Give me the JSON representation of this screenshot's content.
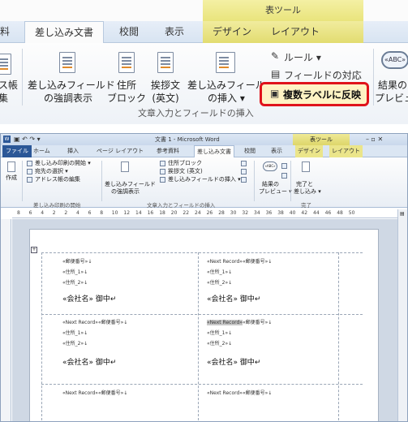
{
  "zoom": {
    "tool_header": "表ツール",
    "tabs": [
      "料",
      "差し込み文書",
      "校閲",
      "表示",
      "デザイン",
      "レイアウト"
    ],
    "buttons": {
      "address_book_l1": "ス帳",
      "address_book_l2": "集",
      "highlight_fields_l1": "差し込みフィールド",
      "highlight_fields_l2": "の強調表示",
      "address_block_l1": "住所",
      "address_block_l2": "ブロック",
      "greeting_l1": "挨拶文",
      "greeting_l2": "(英文)",
      "insert_field_l1": "差し込みフィールド",
      "insert_field_l2": "の挿入 ▾",
      "rules": "ルール ▾",
      "match_fields": "フィールドの対応",
      "update_labels": "複数ラベルに反映",
      "preview_l1": "結果の",
      "preview_l2": "プレビュー"
    },
    "group_label": "文章入力とフィールドの挿入"
  },
  "word": {
    "title": "文書 1 - Microsoft Word",
    "tool_header": "表ツール",
    "tabs": [
      "ファイル",
      "ホーム",
      "挿入",
      "ページ レイアウト",
      "参考資料",
      "差し込み文書",
      "校閲",
      "表示",
      "デザイン",
      "レイアウト"
    ],
    "ribbon": {
      "create": "作成",
      "start_merge": "差し込み印刷の開始 ▾",
      "select_recipients": "宛先の選択 ▾",
      "edit_recipients": "アドレス帳の編集",
      "highlight_l1": "差し込みフィールド",
      "highlight_l2": "の強調表示",
      "address_block": "住所ブロック",
      "greeting": "挨拶文 (英文)",
      "insert_field": "差し込みフィールドの挿入 ▾",
      "preview_l1": "結果の",
      "preview_l2": "プレビュー ▾",
      "finish_l1": "完了と",
      "finish_l2": "差し込み ▾",
      "group_start": "差し込み印刷の開始",
      "group_fields": "文章入力とフィールドの挿入",
      "group_preview": "結果のプレビュー",
      "group_finish": "完了"
    },
    "ruler_numbers": [
      "8",
      "6",
      "4",
      "2",
      "2",
      "4",
      "6",
      "8",
      "10",
      "12",
      "14",
      "16",
      "18",
      "20",
      "22",
      "24",
      "26",
      "28",
      "30",
      "32",
      "34",
      "36",
      "38",
      "40",
      "42",
      "44",
      "46",
      "48",
      "50"
    ],
    "labels": {
      "postal": "«郵便番号»↓",
      "addr1": "«住所_1»↓",
      "addr2": "«住所_2»↓",
      "company": "«会社名» 御中↵",
      "next_postal": "«Next Record»«郵便番号»↓",
      "next_tag": "«Next Record»",
      "postal_short": "«郵便番号»↓"
    }
  }
}
